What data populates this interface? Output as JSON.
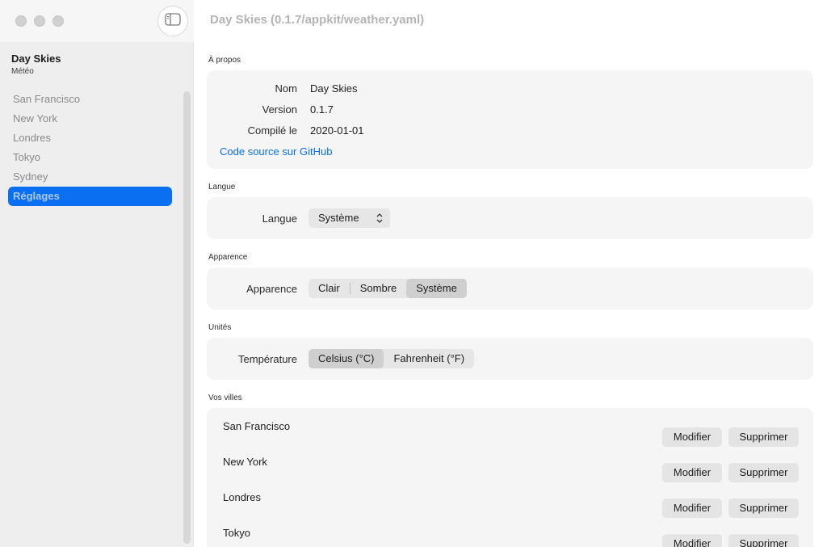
{
  "window": {
    "title": "Day Skies (0.1.7/appkit/weather.yaml)"
  },
  "sidebar": {
    "app_name": "Day Skies",
    "app_subtitle": "Météo",
    "items": [
      {
        "label": "San Francisco",
        "active": false
      },
      {
        "label": "New York",
        "active": false
      },
      {
        "label": "Londres",
        "active": false
      },
      {
        "label": "Tokyo",
        "active": false
      },
      {
        "label": "Sydney",
        "active": false
      },
      {
        "label": "Réglages",
        "active": true
      }
    ]
  },
  "about": {
    "section_label": "À propos",
    "name_key": "Nom",
    "name_value": "Day Skies",
    "version_key": "Version",
    "version_value": "0.1.7",
    "built_key": "Compilé le",
    "built_value": "2020-01-01",
    "link_label": "Code source sur GitHub"
  },
  "language": {
    "section_label": "Langue",
    "field_label": "Langue",
    "selected": "Système"
  },
  "appearance": {
    "section_label": "Apparence",
    "field_label": "Apparence",
    "options": [
      "Clair",
      "Sombre",
      "Système"
    ],
    "selected": "Système"
  },
  "units": {
    "section_label": "Unités",
    "field_label": "Température",
    "options": [
      "Celsius (°C)",
      "Fahrenheit (°F)"
    ],
    "selected": "Celsius (°C)"
  },
  "cities": {
    "section_label": "Vos villes",
    "edit_label": "Modifier",
    "delete_label": "Supprimer",
    "items": [
      "San Francisco",
      "New York",
      "Londres",
      "Tokyo"
    ]
  },
  "colors": {
    "accent": "#0a6ff0",
    "sidebar_bg": "#eeeeee",
    "card_bg": "#f5f5f5"
  },
  "icons": {
    "sidebar_toggle": "sidebar-toggle-icon",
    "select_chevron": "up-down-chevron-icon"
  }
}
